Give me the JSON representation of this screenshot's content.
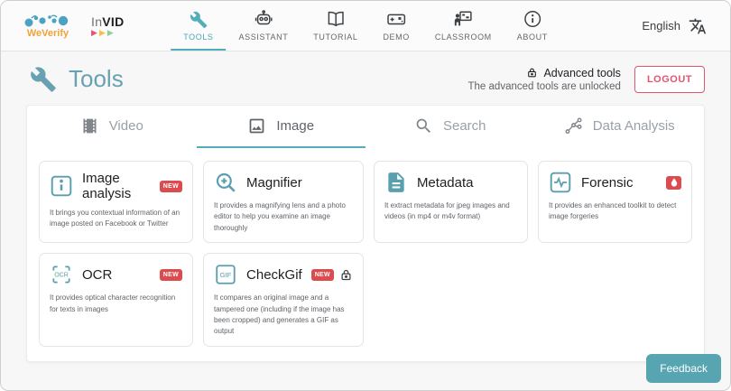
{
  "colors": {
    "accent_teal": "#53aebc",
    "icon_teal": "#5a9fae",
    "badge_red": "#dc4b4e",
    "logout_pink": "#e2556e",
    "feedback_teal": "#57a5b1"
  },
  "header": {
    "weverify_logo_text": "WeVerify",
    "invid_logo_in": "In",
    "invid_logo_vid": "VID",
    "invid_triangle": "▶",
    "nav": [
      {
        "label": "TOOLS",
        "icon": "wrench-icon",
        "active": true
      },
      {
        "label": "ASSISTANT",
        "icon": "robot-icon",
        "active": false
      },
      {
        "label": "TUTORIAL",
        "icon": "book-icon",
        "active": false
      },
      {
        "label": "DEMO",
        "icon": "gamepad-icon",
        "active": false
      },
      {
        "label": "CLASSROOM",
        "icon": "presenter-icon",
        "active": false
      },
      {
        "label": "ABOUT",
        "icon": "info-circle-icon",
        "active": false
      }
    ],
    "language": {
      "label": "English",
      "icon": "translate-icon"
    }
  },
  "page_header": {
    "title": "Tools",
    "title_icon": "wrench-icon",
    "advanced_tools": {
      "icon": "lock-icon",
      "label": "Advanced tools",
      "status": "The advanced tools are unlocked"
    },
    "logout_label": "LOGOUT"
  },
  "tabs": [
    {
      "label": "Video",
      "icon": "film-icon",
      "active": false
    },
    {
      "label": "Image",
      "icon": "image-icon",
      "active": true
    },
    {
      "label": "Search",
      "icon": "search-icon",
      "active": false
    },
    {
      "label": "Data Analysis",
      "icon": "scatter-graph-icon",
      "active": false
    }
  ],
  "cards": [
    {
      "title": "Image analysis",
      "icon": "info-square-icon",
      "badge": "NEW",
      "description": "It brings you contextual information of an image posted on Facebook or Twitter"
    },
    {
      "title": "Magnifier",
      "icon": "zoom-in-icon",
      "description": "It provides a magnifying lens and a photo editor to help you examine an image thoroughly"
    },
    {
      "title": "Metadata",
      "icon": "document-icon",
      "description": "It extract metadata for jpeg images and videos (in mp4 or m4v format)"
    },
    {
      "title": "Forensic",
      "icon": "waveform-square-icon",
      "badge_icon": "flame-badge-icon",
      "description": "It provides an enhanced toolkit to detect image forgeries"
    },
    {
      "title": "OCR",
      "icon": "ocr-scan-icon",
      "icon_text": "OCR",
      "badge": "NEW",
      "description": "It provides optical character recognition for texts in images"
    },
    {
      "title": "CheckGif",
      "icon": "gif-icon",
      "icon_text": "GIF",
      "badge": "NEW",
      "lock_icon": "lock-icon",
      "description": "It compares an original image and a tampered one (including if the image has been cropped) and generates a GIF as output"
    }
  ],
  "footer": {
    "feedback_label": "Feedback"
  }
}
